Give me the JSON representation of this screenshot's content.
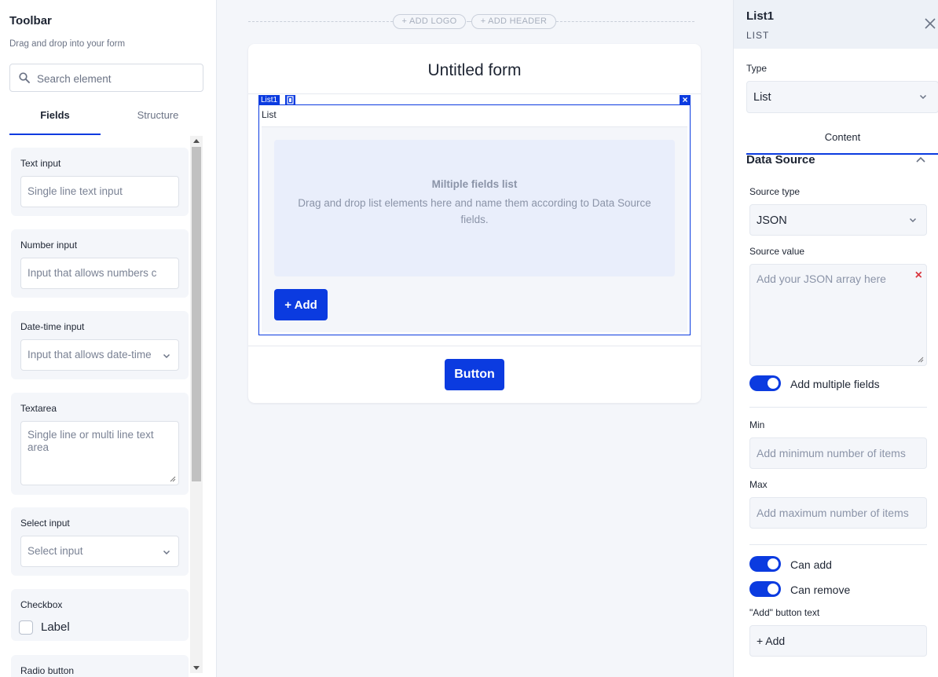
{
  "toolbar": {
    "title": "Toolbar",
    "subtitle": "Drag and drop into your form",
    "search_placeholder": "Search element",
    "tabs": [
      "Fields",
      "Structure"
    ],
    "items": [
      {
        "label": "Text input",
        "placeholder": "Single line text input"
      },
      {
        "label": "Number input",
        "placeholder": "Input that allows numbers c"
      },
      {
        "label": "Date-time input",
        "placeholder": "Input that allows date-time"
      },
      {
        "label": "Textarea",
        "placeholder": "Single line or multi line text area"
      },
      {
        "label": "Select input",
        "placeholder": "Select input"
      },
      {
        "label": "Checkbox",
        "option": "Label"
      },
      {
        "label": "Radio button"
      }
    ]
  },
  "canvas": {
    "add_logo": "+ ADD LOGO",
    "add_header": "+ ADD HEADER",
    "form_title": "Untitled form",
    "list_tag": "List1",
    "list_close": "×",
    "list_name": "List",
    "drop_title": "Miltiple fields list",
    "drop_desc": "Drag and drop list elements here and name them according to Data Source fields.",
    "add_button": "+ Add",
    "submit_button": "Button"
  },
  "panel": {
    "title": "List1",
    "subtitle": "LIST",
    "type_label": "Type",
    "type_value": "List",
    "tab": "Content",
    "section": "Data Source",
    "source_type_label": "Source type",
    "source_type_value": "JSON",
    "source_value_label": "Source value",
    "source_value_placeholder": "Add your JSON array here",
    "clear_symbol": "×",
    "multiple_fields_label": "Add multiple fields",
    "min_label": "Min",
    "min_placeholder": "Add minimum number of items",
    "max_label": "Max",
    "max_placeholder": "Add maximum number of items",
    "can_add_label": "Can add",
    "can_remove_label": "Can remove",
    "add_text_label": "\"Add\" button text",
    "add_text_value": "+ Add"
  },
  "colors": {
    "accent": "#0b3be0",
    "canvas_bg": "#f4f6fa",
    "error": "#d9363e"
  },
  "icons": [
    "search-icon",
    "chevron-down-icon",
    "chevron-up-icon",
    "close-icon",
    "copy-icon",
    "resize-grip-icon"
  ]
}
